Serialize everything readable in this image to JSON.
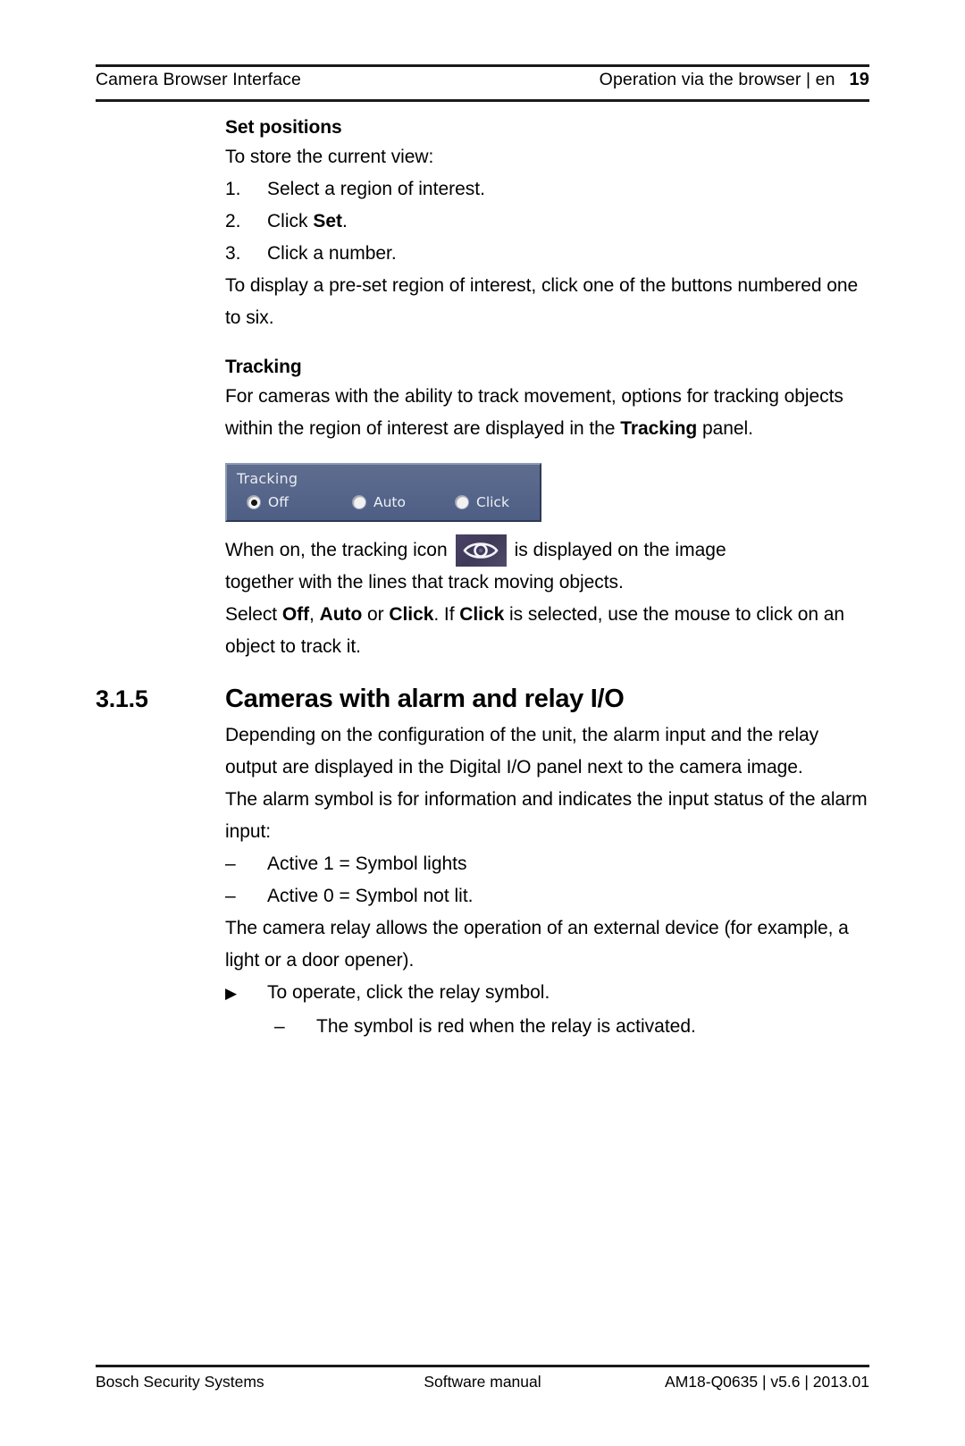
{
  "header": {
    "left_title": "Camera Browser Interface",
    "right_crumb": "Operation via the browser | en",
    "page_number": "19"
  },
  "body": {
    "set_positions": {
      "heading": "Set positions",
      "intro": "To store the current view:",
      "steps": [
        {
          "num": "1.",
          "text": "Select a region of interest."
        },
        {
          "num": "2.",
          "text_before": "Click ",
          "bold": "Set",
          "text_after": "."
        },
        {
          "num": "3.",
          "text": "Click a number."
        }
      ],
      "after_steps": "To display a pre-set region of interest, click one of the buttons numbered one to six."
    },
    "tracking": {
      "heading": "Tracking",
      "intro_before": "For cameras with the ability to track movement, options for tracking objects within the region of interest are displayed in the ",
      "intro_bold": "Tracking",
      "intro_after": " panel.",
      "panel": {
        "title": "Tracking",
        "options": [
          {
            "label": "Off",
            "selected": true
          },
          {
            "label": "Auto",
            "selected": false
          },
          {
            "label": "Click",
            "selected": false
          }
        ]
      },
      "icon_sentence_before": "When on, the tracking icon",
      "icon_name": "tracking-eye-icon",
      "icon_sentence_after": "is displayed on the image",
      "icon_sentence_line2": "together with the lines that track moving objects.",
      "select_line_parts": [
        {
          "text": "Select ",
          "bold": false
        },
        {
          "text": "Off",
          "bold": true
        },
        {
          "text": ", ",
          "bold": false
        },
        {
          "text": "Auto",
          "bold": true
        },
        {
          "text": " or ",
          "bold": false
        },
        {
          "text": "Click",
          "bold": true
        },
        {
          "text": ". If ",
          "bold": false
        },
        {
          "text": "Click",
          "bold": true
        },
        {
          "text": " is selected, use the mouse to click on an object to track it.",
          "bold": false
        }
      ]
    },
    "section_315": {
      "number": "3.1.5",
      "title": "Cameras with alarm and relay I/O",
      "para1": "Depending on the configuration of the unit, the alarm input and the relay output are displayed in the Digital I/O panel next to the camera image.",
      "para2": "The alarm symbol is for information and indicates the input status of the alarm input:",
      "dashes": [
        "Active 1 = Symbol lights",
        "Active 0 = Symbol not lit."
      ],
      "para3": "The camera relay allows the operation of an external device (for example, a light or a door opener).",
      "triangle_item": "To operate, click the relay symbol.",
      "sub_dash": "The symbol is red when the relay is activated."
    }
  },
  "footer": {
    "left": "Bosch Security Systems",
    "center": "Software manual",
    "right": "AM18-Q0635 | v5.6 | 2013.01"
  },
  "colors": {
    "panel_background": "#55658a",
    "panel_text": "#eef0f5",
    "icon_background": "#474060",
    "rule": "#1a1a1a"
  }
}
